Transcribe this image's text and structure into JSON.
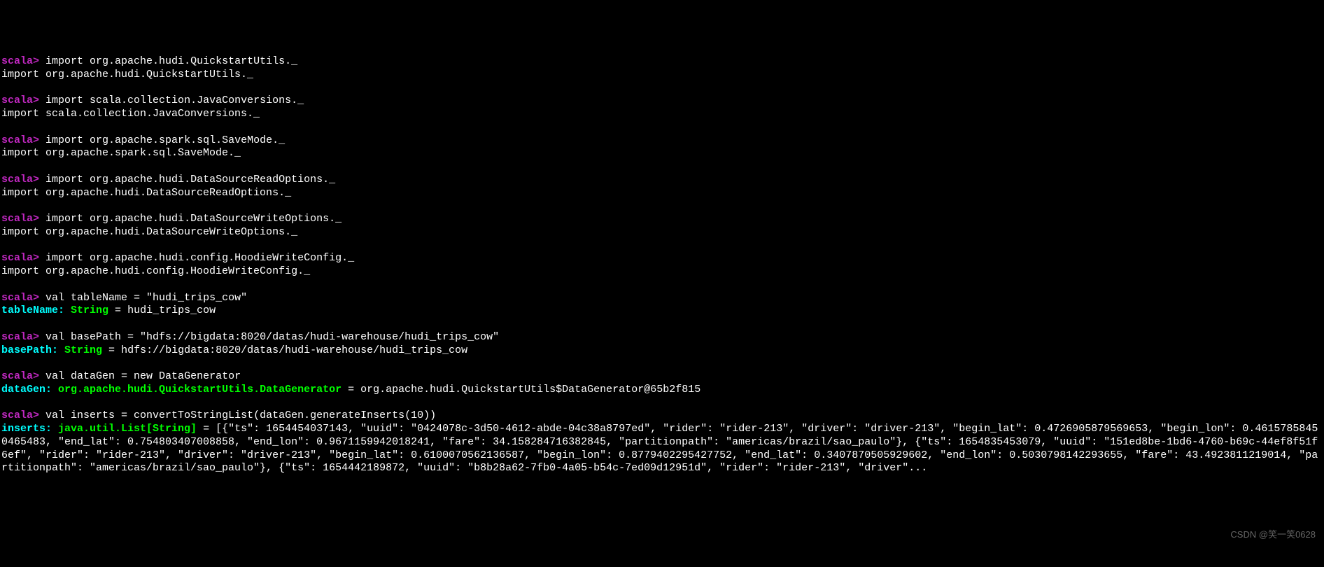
{
  "prompt": "scala>",
  "blocks": [
    {
      "cmd": "import org.apache.hudi.QuickstartUtils._",
      "echo": "import org.apache.hudi.QuickstartUtils._"
    },
    {
      "cmd": "import scala.collection.JavaConversions._",
      "echo": "import scala.collection.JavaConversions._"
    },
    {
      "cmd": "import org.apache.spark.sql.SaveMode._",
      "echo": "import org.apache.spark.sql.SaveMode._"
    },
    {
      "cmd": "import org.apache.hudi.DataSourceReadOptions._",
      "echo": "import org.apache.hudi.DataSourceReadOptions._"
    },
    {
      "cmd": "import org.apache.hudi.DataSourceWriteOptions._",
      "echo": "import org.apache.hudi.DataSourceWriteOptions._"
    },
    {
      "cmd": "import org.apache.hudi.config.HoodieWriteConfig._",
      "echo": "import org.apache.hudi.config.HoodieWriteConfig._"
    }
  ],
  "vals": [
    {
      "cmd": "val tableName = \"hudi_trips_cow\"",
      "var": "tableName",
      "type": "String",
      "value": "hudi_trips_cow"
    },
    {
      "cmd": "val basePath = \"hdfs://bigdata:8020/datas/hudi-warehouse/hudi_trips_cow\"",
      "var": "basePath",
      "type": "String",
      "value": "hdfs://bigdata:8020/datas/hudi-warehouse/hudi_trips_cow"
    },
    {
      "cmd": "val dataGen = new DataGenerator",
      "var": "dataGen",
      "type": "org.apache.hudi.QuickstartUtils.DataGenerator",
      "value": "org.apache.hudi.QuickstartUtils$DataGenerator@65b2f815"
    }
  ],
  "inserts": {
    "cmd": "val inserts = convertToStringList(dataGen.generateInserts(10))",
    "var": "inserts",
    "type": "java.util.List[String]",
    "value": "[{\"ts\": 1654454037143, \"uuid\": \"0424078c-3d50-4612-abde-04c38a8797ed\", \"rider\": \"rider-213\", \"driver\": \"driver-213\", \"begin_lat\": 0.4726905879569653, \"begin_lon\": 0.46157858450465483, \"end_lat\": 0.754803407008858, \"end_lon\": 0.9671159942018241, \"fare\": 34.158284716382845, \"partitionpath\": \"americas/brazil/sao_paulo\"}, {\"ts\": 1654835453079, \"uuid\": \"151ed8be-1bd6-4760-b69c-44ef8f51f6ef\", \"rider\": \"rider-213\", \"driver\": \"driver-213\", \"begin_lat\": 0.6100070562136587, \"begin_lon\": 0.8779402295427752, \"end_lat\": 0.3407870505929602, \"end_lon\": 0.5030798142293655, \"fare\": 43.4923811219014, \"partitionpath\": \"americas/brazil/sao_paulo\"}, {\"ts\": 1654442189872, \"uuid\": \"b8b28a62-7fb0-4a05-b54c-7ed09d12951d\", \"rider\": \"rider-213\", \"driver\"..."
  },
  "watermark": "CSDN @笑一笑0628"
}
